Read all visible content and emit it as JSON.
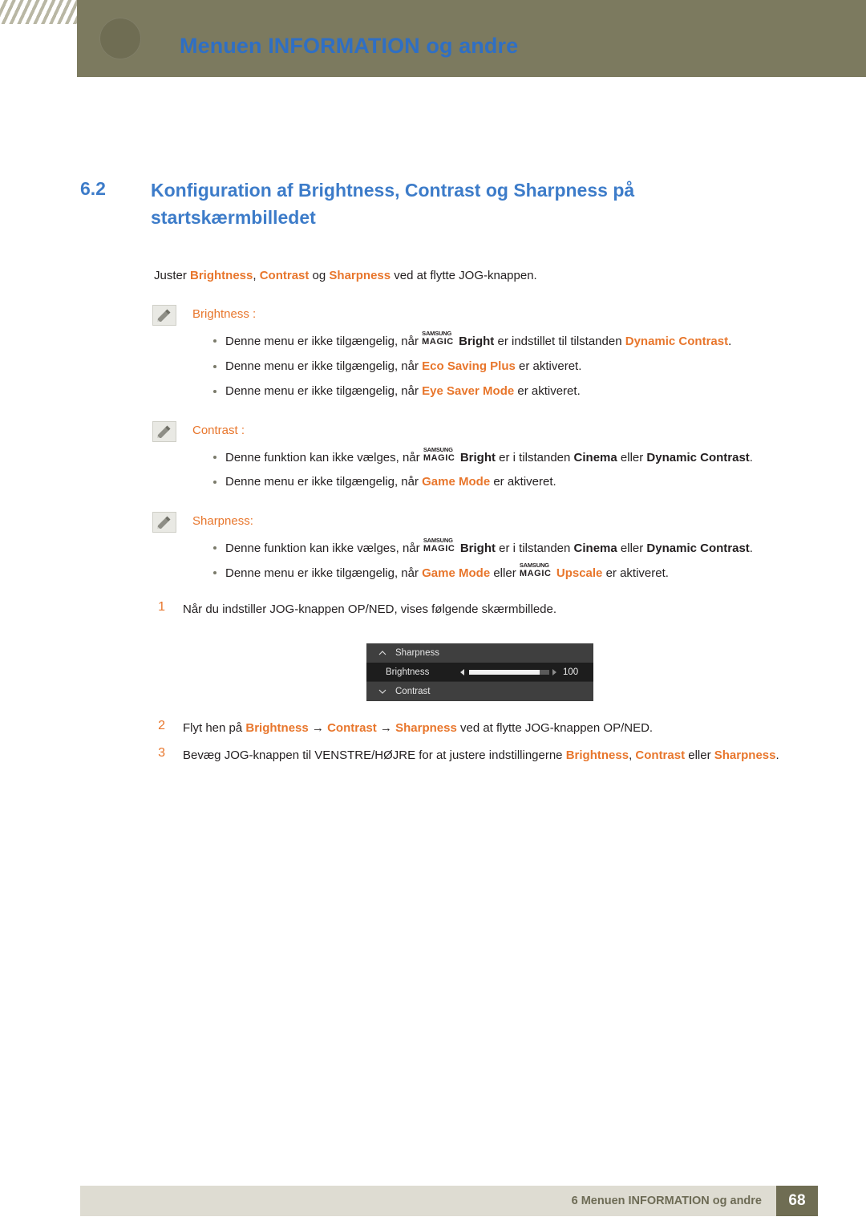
{
  "header": {
    "title": "Menuen INFORMATION og andre",
    "logo_icon": "circle-logo-icon",
    "hatch_icon": "diagonal-hatch-decoration"
  },
  "section": {
    "number": "6.2",
    "title": "Konfiguration af Brightness, Contrast og Sharpness på startskærmbilledet"
  },
  "intro": {
    "prefix": "Juster ",
    "term1": "Brightness",
    "comma": ", ",
    "term2": "Contrast",
    "and": " og ",
    "term3": "Sharpness",
    "suffix": " ved at flytte JOG-knappen."
  },
  "notes": [
    {
      "icon": "note-pencil-icon",
      "label": "Brightness :",
      "bullets": [
        {
          "pre": "Denne menu er ikke tilgængelig, når ",
          "magic": {
            "top": "SAMSUNG",
            "bottom": "MAGIC"
          },
          "mid1": "Bright",
          "mid2": " er indstillet til tilstanden ",
          "term": "Dynamic Contrast",
          "post": "."
        },
        {
          "pre": "Denne menu er ikke tilgængelig, når ",
          "term": "Eco Saving Plus",
          "post": " er aktiveret."
        },
        {
          "pre": "Denne menu er ikke tilgængelig, når ",
          "term": "Eye Saver Mode",
          "post": " er aktiveret."
        }
      ]
    },
    {
      "icon": "note-pencil-icon",
      "label": "Contrast :",
      "bullets": [
        {
          "pre": "Denne funktion kan ikke vælges, når ",
          "magic": {
            "top": "SAMSUNG",
            "bottom": "MAGIC"
          },
          "mid1": "Bright",
          "mid2": " er i tilstanden ",
          "term": "Cinema",
          "or": " eller ",
          "term2": "Dynamic Contrast",
          "post": "."
        },
        {
          "pre": "Denne menu er ikke tilgængelig, når ",
          "term": "Game Mode",
          "post": " er aktiveret."
        }
      ]
    },
    {
      "icon": "note-pencil-icon",
      "label": "Sharpness:",
      "bullets": [
        {
          "pre": "Denne funktion kan ikke vælges, når ",
          "magic": {
            "top": "SAMSUNG",
            "bottom": "MAGIC"
          },
          "mid1": "Bright",
          "mid2": " er i tilstanden ",
          "term": "Cinema",
          "or": " eller ",
          "term2": "Dynamic Contrast",
          "post": "."
        },
        {
          "pre": "Denne menu er ikke tilgængelig, når ",
          "term": "Game Mode",
          "mid": " eller ",
          "magic": {
            "top": "SAMSUNG",
            "bottom": "MAGIC"
          },
          "term2": "Upscale",
          "post": " er aktiveret."
        }
      ]
    }
  ],
  "steps": [
    {
      "num": "1",
      "text": "Når du indstiller JOG-knappen OP/NED, vises følgende skærmbillede."
    },
    {
      "num": "2",
      "pre": "Flyt hen på ",
      "t1": "Brightness",
      "a1": " → ",
      "t2": "Contrast",
      "a2": " → ",
      "t3": "Sharpness",
      "post": " ved at flytte JOG-knappen OP/NED."
    },
    {
      "num": "3",
      "pre": "Bevæg JOG-knappen til VENSTRE/HØJRE for at justere indstillingerne ",
      "t1": "Brightness",
      "sep": ", ",
      "t2": "Contrast",
      "mid": " eller ",
      "t3": "Sharpness",
      "post": "."
    }
  ],
  "osd": {
    "row_top_label": "Sharpness",
    "row_mid_label": "Brightness",
    "row_bottom_label": "Contrast",
    "value": "100",
    "slider_percent": 88,
    "caret_up_icon": "chevron-up-icon",
    "caret_down_icon": "chevron-down-icon",
    "arrow_left_icon": "arrow-left-icon",
    "arrow_right_icon": "arrow-right-icon"
  },
  "footer": {
    "text": "6 Menuen INFORMATION og andre",
    "page": "68"
  },
  "colors": {
    "header_band": "#7c7a5f",
    "title_blue": "#2f6fc4",
    "heading_blue": "#3d7cc9",
    "accent_orange": "#e8762c",
    "footer_bar": "#dedcd2",
    "page_box": "#6f6d53",
    "osd_bg": "#3a3a3a"
  }
}
